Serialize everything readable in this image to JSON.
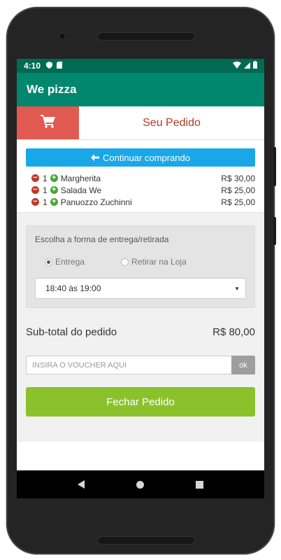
{
  "status_bar": {
    "time": "4:10"
  },
  "app": {
    "title": "We pizza"
  },
  "order_header": {
    "title": "Seu Pedido"
  },
  "continue_button": {
    "label": "Continuar comprando"
  },
  "items": [
    {
      "qty": "1",
      "name": "Margherita",
      "price": "R$ 30,00"
    },
    {
      "qty": "1",
      "name": "Salada We",
      "price": "R$ 25,00"
    },
    {
      "qty": "1",
      "name": "Panuozzo Zuchinni",
      "price": "R$ 25,00"
    }
  ],
  "delivery": {
    "title": "Escolha a forma de entrega/retirada",
    "option_delivery": "Entrega",
    "option_pickup": "Retirar na Loja",
    "selected": "Entrega",
    "time_slot": "18:40 às 19:00"
  },
  "subtotal": {
    "label": "Sub-total do pedido",
    "value": "R$ 80,00"
  },
  "voucher": {
    "placeholder": "INSIRA O VOUCHER AQUI",
    "value": "",
    "ok_label": "ok"
  },
  "checkout": {
    "label": "Fechar Pedido"
  },
  "colors": {
    "status_bar": "#006a53",
    "app_bar": "#00876e",
    "cart_box": "#e05a52",
    "order_title": "#b23a2b",
    "continue_button": "#1aa7e8",
    "checkout_button": "#8bc12b",
    "minus": "#c0392b",
    "plus": "#46a537"
  },
  "icons": {
    "cart": "shopping-cart-icon",
    "arrow_left": "arrow-left-icon",
    "minus": "minus-circle-icon",
    "plus": "plus-circle-icon"
  }
}
